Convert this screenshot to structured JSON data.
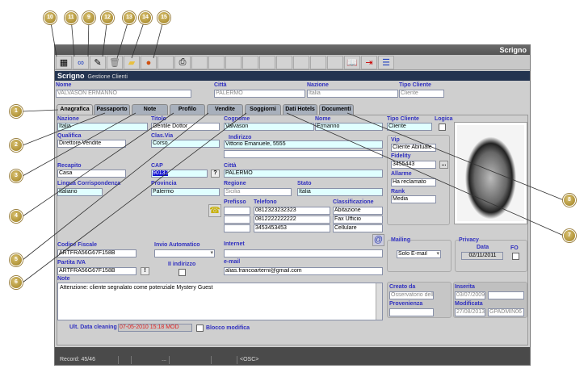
{
  "window": {
    "brand": "Scrigno",
    "module": "Gestione Clienti"
  },
  "toolbar": {
    "icons": [
      "calculator-icon",
      "binoculars-icon",
      "edit-icon",
      "trash-icon",
      "folder-icon",
      "user-icon",
      "",
      "printer-icon",
      "",
      "",
      "",
      "",
      "",
      "",
      "",
      "",
      "",
      "book-icon",
      "exit-icon",
      "list-icon"
    ]
  },
  "header_fields": {
    "nome_label": "Nome",
    "nome": "VALVASON ERMANNO",
    "citta_label": "Città",
    "citta": "PALERMO",
    "nazione_label": "Nazione",
    "nazione": "Italia",
    "tipo_label": "Tipo Cliente",
    "tipo": "Cliente"
  },
  "tabs": [
    "Anagrafica",
    "Passaporto",
    "Note",
    "Profilo",
    "Vendite",
    "Soggiorni",
    "Dati Hotels",
    "Documenti"
  ],
  "form": {
    "nazione_label": "Nazione",
    "nazione": "Italia",
    "titolo_label": "Titolo",
    "titolo": "Gentile Dottor",
    "cognome_label": "Cognome",
    "cognome": "Valvason",
    "nome_label": "Nome",
    "nome": "Ermanno",
    "tipo_label": "Tipo Cliente",
    "tipo": "Cliente",
    "logica_label": "Logica",
    "qualifica_label": "Qualifica",
    "qualifica": "Direttore Vendite",
    "clasvia_label": "Clas.Via",
    "clasvia": "Corso",
    "indirizzo_label": "Indirizzo",
    "indirizzo": "Vittorio Emanuele, 5555",
    "indirizzo2": "",
    "recapito_label": "Recapito",
    "recapito": "Casa",
    "cap_label": "CAP",
    "cap": "90132",
    "cap_btn": "?",
    "citta_label": "Città",
    "citta": "PALERMO",
    "lingua_label": "Lingua Corrispondenza",
    "lingua": "Italiano",
    "provincia_label": "Provincia",
    "provincia": "Palermo",
    "regione_label": "Regione",
    "regione": "Sicilia",
    "stato_label": "Stato",
    "stato": "Italia",
    "prefisso_label": "Prefisso",
    "telefono_label": "Telefono",
    "class_label": "Classificazione",
    "phones": [
      {
        "pref": "",
        "tel": "0812323232323",
        "cls": "Abitazione"
      },
      {
        "pref": "",
        "tel": "0812222222222",
        "cls": "Fax Ufficio"
      },
      {
        "pref": "",
        "tel": "3453453453",
        "cls": "Cellulare"
      }
    ],
    "vip_label": "Vip",
    "vip": "Cliente Abituale",
    "fidelity_label": "Fidelity",
    "fidelity": "3455443",
    "fidelity_btn": "...",
    "allarme_label": "Allarme",
    "allarme": "Ha reclamato",
    "rank_label": "Rank",
    "rank": "Media",
    "cf_label": "Codice Fiscale",
    "cf": "ARTFRA56G67F158B",
    "invio_label": "Invio Automatico",
    "invio": "",
    "internet_label": "Internet",
    "internet": "",
    "piva_label": "Partita IVA",
    "piva": "ARTFRA56G67F158B",
    "piva_btn": "!",
    "ii_label": "II indirizzo",
    "email_label": "e-mail",
    "email": "alias.francoarterni@gmail.com",
    "note_label": "Note",
    "note": "Attenzione: cliente segnalato come potenziale Mystery Guest",
    "mailing_label": "Mailing",
    "mailing": "Solo E-mail",
    "privacy_label": "Privacy",
    "data_label": "Data",
    "privacy_data": "02/11/2011",
    "fo_label": "FO",
    "creato_label": "Creato da",
    "creato": "Osservatorio della",
    "provenienza_label": "Provenienza",
    "provenienza": "",
    "inserita_label": "Inserita",
    "inserita": "03/07/2009",
    "inserita2": "",
    "modificata_label": "Modificata",
    "modificata": "27/08/2013",
    "modificata2": "GPADMIN06",
    "cleaning_label": "Ult. Data cleaning",
    "cleaning": "07-05-2010 15:18 MOD",
    "blocco_label": "Blocco modifica"
  },
  "status": {
    "record": "Record: 45/46",
    "dots": "...",
    "osc": "<OSC>"
  },
  "callouts": [
    "10",
    "11",
    "9",
    "12",
    "13",
    "14",
    "15",
    "1",
    "2",
    "3",
    "4",
    "5",
    "6",
    "8",
    "7"
  ],
  "colors": {
    "label": "#3030c0",
    "header": "#243450",
    "field_cyan": "#e0ffff",
    "callout": "#b09030"
  }
}
